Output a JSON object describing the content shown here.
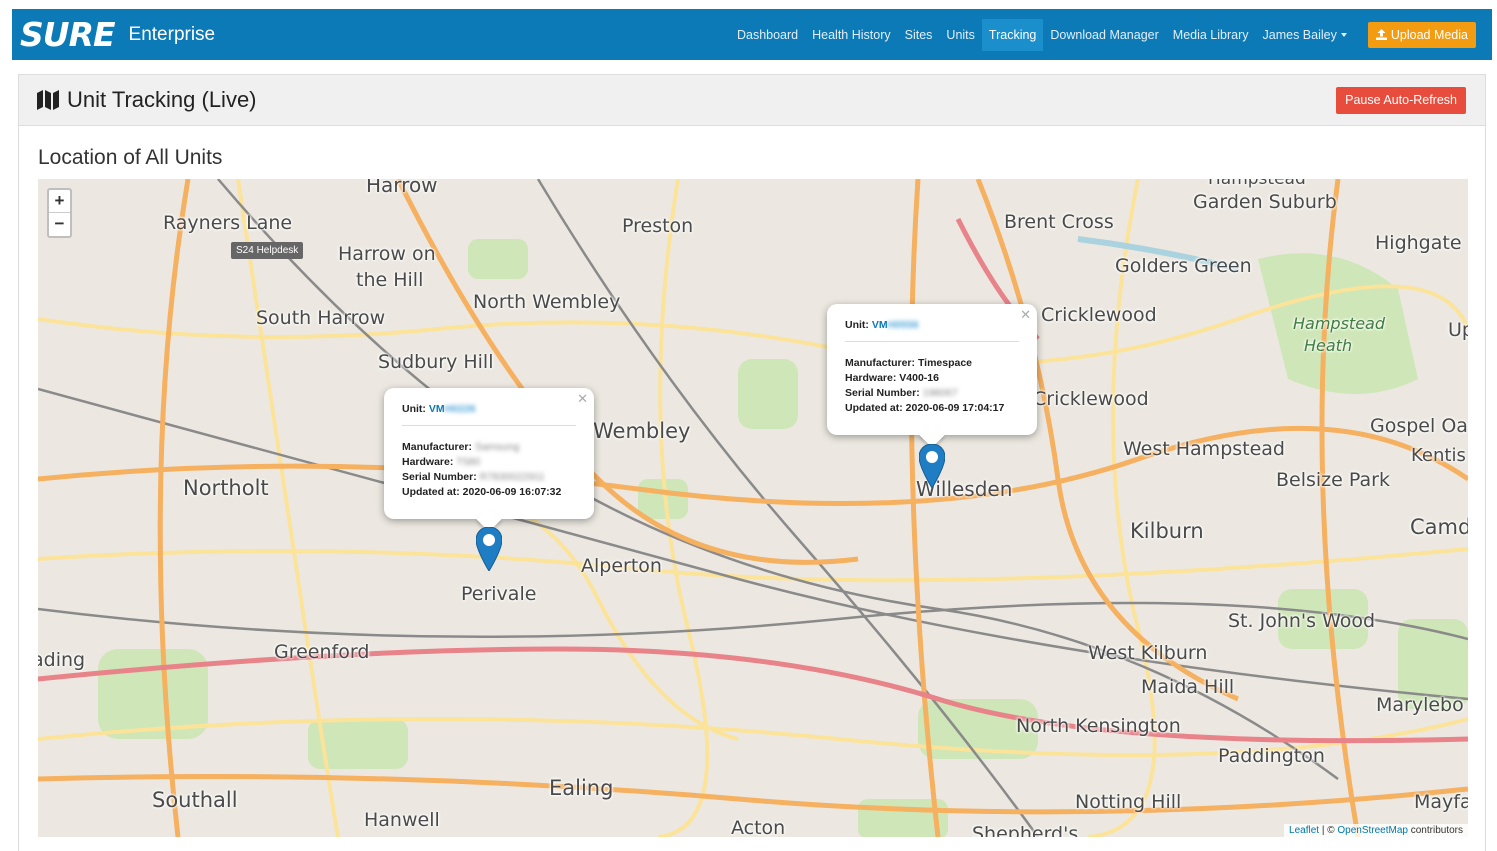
{
  "header": {
    "logo": "SURE",
    "subtitle": "Enterprise",
    "nav": [
      "Dashboard",
      "Health History",
      "Sites",
      "Units",
      "Tracking",
      "Download Manager",
      "Media Library"
    ],
    "active_nav": "Tracking",
    "user": "James Bailey",
    "upload_label": "Upload Media"
  },
  "panel": {
    "title": "Unit Tracking (Live)",
    "pause_label": "Pause Auto-Refresh",
    "section_title": "Location of All Units"
  },
  "map": {
    "zoom_in": "+",
    "zoom_out": "−",
    "tooltip": "S24 Helpdesk",
    "attribution": {
      "leaflet": "Leaflet",
      "sep": " | © ",
      "osm": "OpenStreetMap",
      "suffix": " contributors"
    },
    "places": [
      "Harrow",
      "Rayners Lane",
      "Harrow on",
      "the Hill",
      "Preston",
      "Brent Cross",
      "Garden Suburb",
      "Highgate",
      "Golders Green",
      "North Wembley",
      "South Harrow",
      "Cricklewood",
      "Hampstead",
      "Heath",
      "Sudbury Hill",
      "Wembley",
      "Cricklewood",
      "West Hampstead",
      "Gospel Oa",
      "Kentis",
      "Northolt",
      "Willesden",
      "Belsize Park",
      "Kilburn",
      "Camd",
      "Alperton",
      "Perivale",
      "St. John's Wood",
      "West Kilburn",
      "Greenford",
      "Reading",
      "Maida Hill",
      "Marylebo",
      "North Kensington",
      "Paddington",
      "Southall",
      "Ealing",
      "Notting Hill",
      "Mayfa",
      "Hanwell",
      "Acton",
      "Shepherd's",
      "Up",
      "Hampstead"
    ],
    "popups": [
      {
        "unit_label": "Unit:",
        "unit_prefix": "VM",
        "unit_masked": "H0226",
        "manufacturer_label": "Manufacturer:",
        "manufacturer": "Samsung",
        "hardware_label": "Hardware:",
        "hardware": "T580",
        "serial_label": "Serial Number:",
        "serial": "R7830022911",
        "updated_label": "Updated at:",
        "updated": "2020-06-09 16:07:32"
      },
      {
        "unit_label": "Unit:",
        "unit_prefix": "VM",
        "unit_masked": "H0556",
        "manufacturer_label": "Manufacturer:",
        "manufacturer": "Timespace",
        "hardware_label": "Hardware:",
        "hardware": "V400-16",
        "serial_label": "Serial Number:",
        "serial": "198067",
        "updated_label": "Updated at:",
        "updated": "2020-06-09 17:04:17"
      }
    ],
    "colors": {
      "marker": "#1f7dc4",
      "road_major": "#f5b060",
      "road_minor": "#fbe39a",
      "park": "#cfe6b8",
      "rail": "#8a8a8a"
    }
  }
}
